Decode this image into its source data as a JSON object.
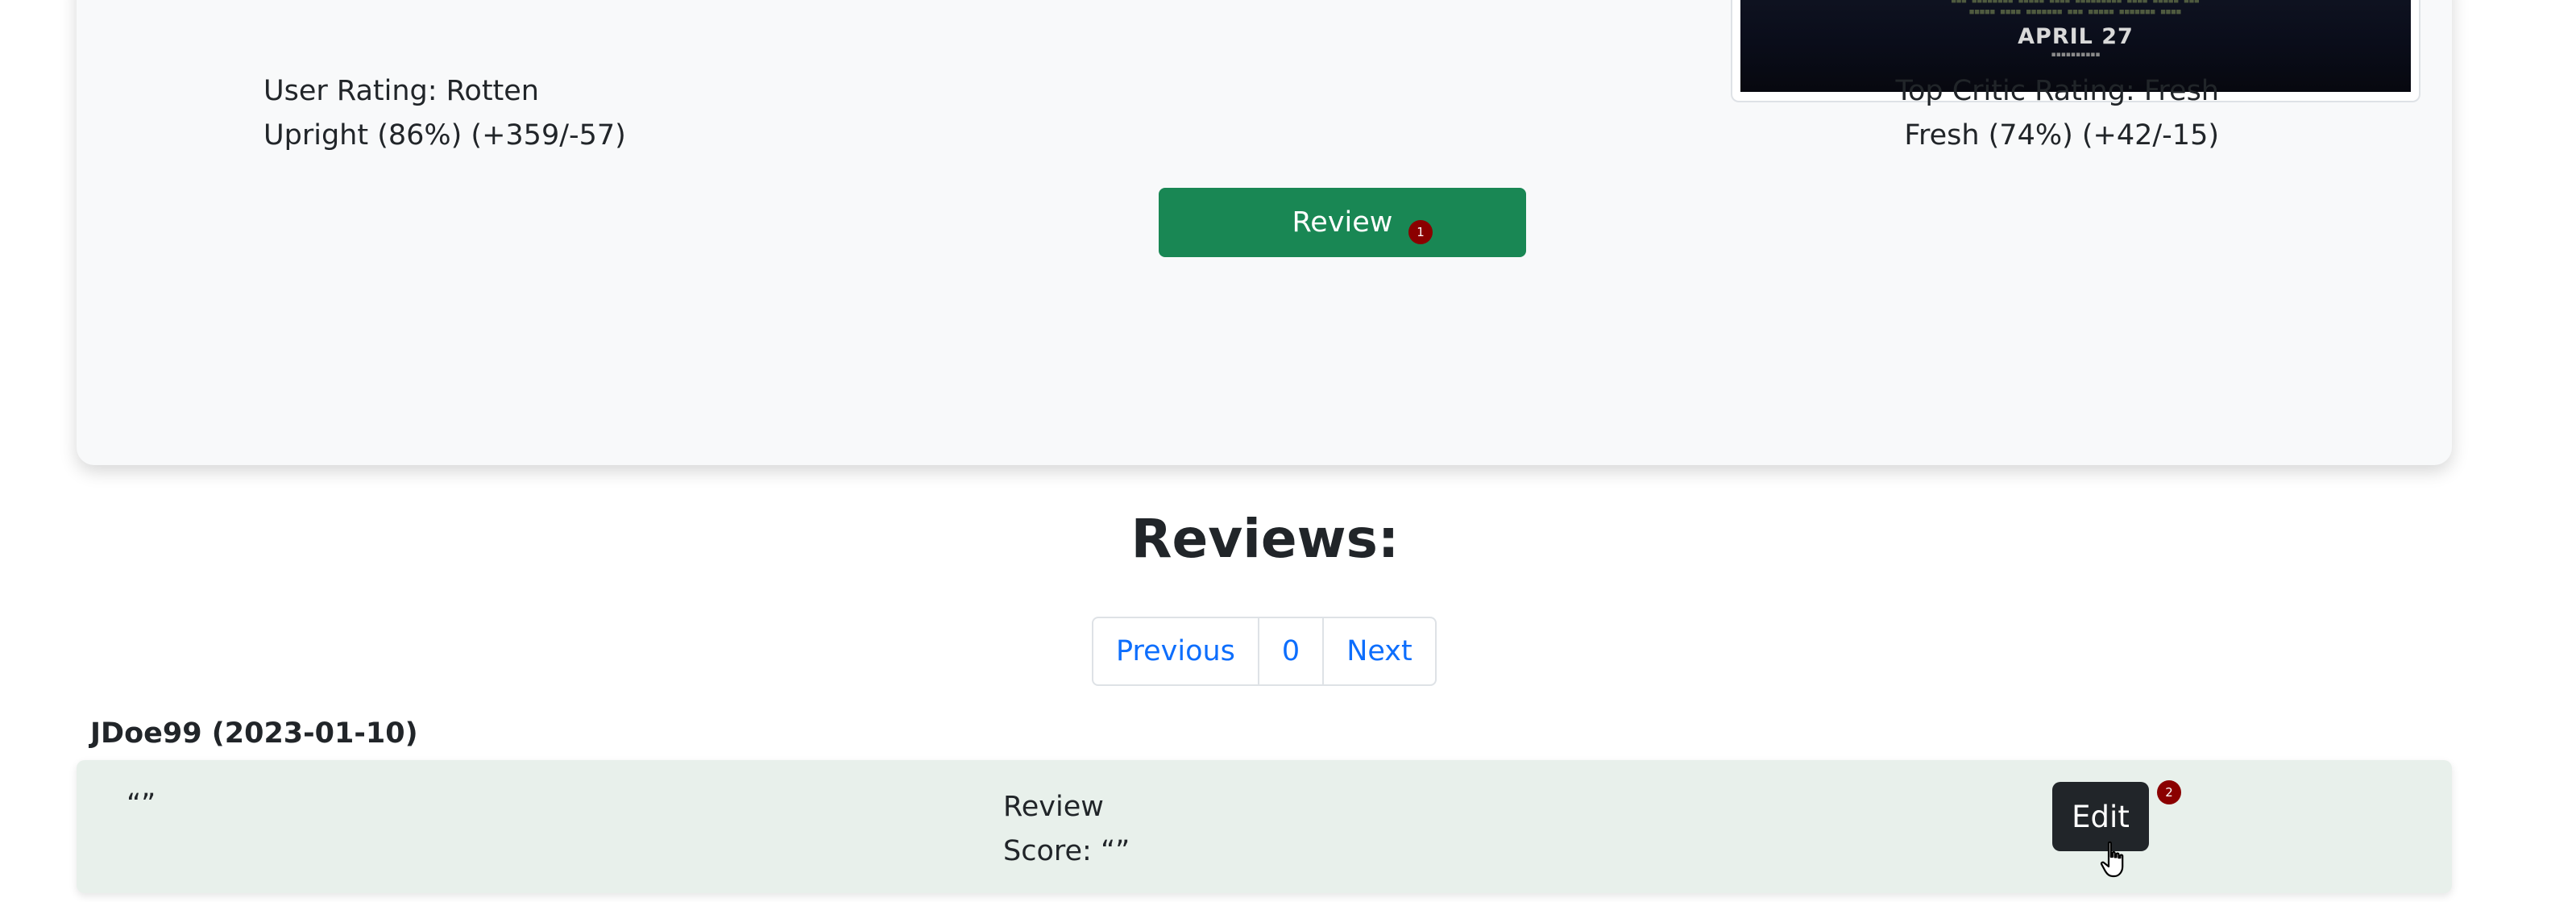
{
  "movie": {
    "poster": {
      "date_text": "APRIL 27"
    },
    "user_rating": {
      "line1": "User Rating: Rotten",
      "line2": "Upright (86%) (+359/-57)"
    },
    "critic_rating": {
      "line1": "Top Critic Rating: Fresh",
      "line2": "Fresh (74%) (+42/-15)"
    },
    "review_button": {
      "label": "Review",
      "badge": "1"
    }
  },
  "reviews": {
    "title": "Reviews:",
    "pagination": {
      "previous": "Previous",
      "current": "0",
      "next": "Next"
    },
    "items": [
      {
        "author": "JDoe99 (2023-01-10)",
        "text": "“”",
        "score_line1": "Review",
        "score_line2": "Score: “”",
        "edit_label": "Edit",
        "edit_badge": "2"
      }
    ]
  },
  "colors": {
    "card_bg": "#f8f9fa",
    "review_button": "#198754",
    "badge": "#8b0000",
    "link": "#0d6efd",
    "edit_button": "#212529",
    "review_row_bg": "#e8f0eb"
  },
  "icons": {
    "cursor": "hand-pointer-icon"
  }
}
